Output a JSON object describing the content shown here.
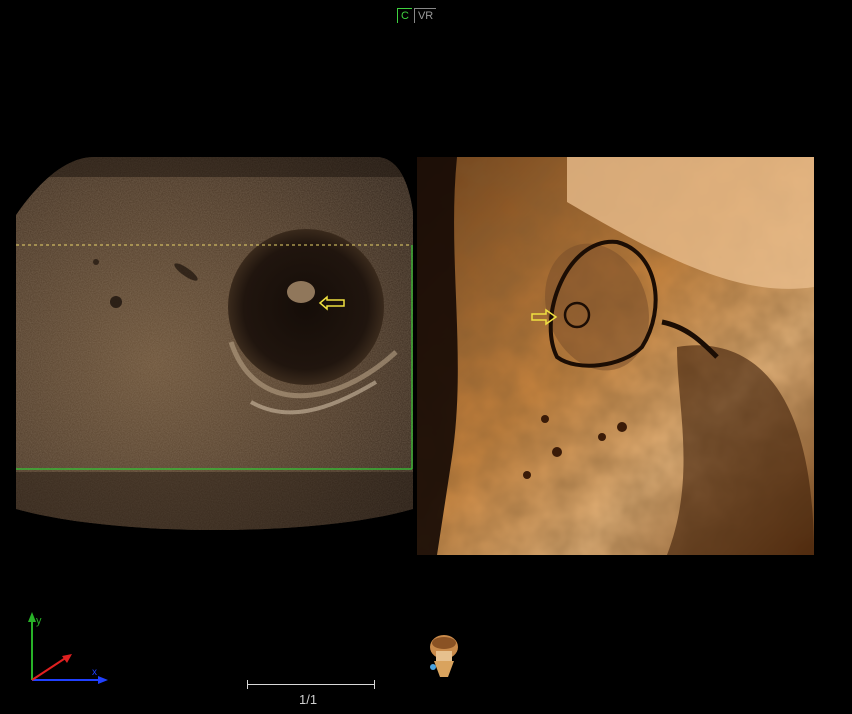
{
  "view_modes": [
    {
      "label": "C",
      "active": true
    },
    {
      "label": "VR",
      "active": false
    }
  ],
  "axes": {
    "y_label": "y",
    "x_label": "x",
    "y_color": "#28b228",
    "x_color": "#2040ff",
    "z_color": "#e02020"
  },
  "overlay_color": "#35c935",
  "clip_line_color": "#e8d36a",
  "arrow_color": "#f0e040",
  "pagination": {
    "label": "1/1"
  }
}
